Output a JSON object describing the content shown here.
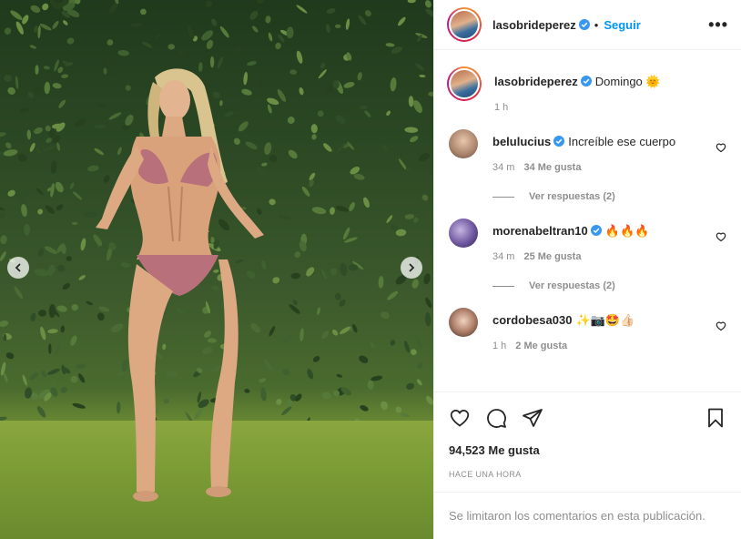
{
  "colors": {
    "accent": "#0095f6",
    "text": "#262626",
    "muted": "#8e8e8e",
    "border": "#efefef",
    "verified": "#3897f0"
  },
  "header": {
    "username": "lasobrideperez",
    "separator": "•",
    "follow_label": "Seguir",
    "more_icon": "more-horizontal-icon"
  },
  "caption": {
    "username": "lasobrideperez",
    "text": "Domingo 🌞",
    "time": "1 h"
  },
  "comments": [
    {
      "username": "belulucius",
      "verified": true,
      "text": "Increíble ese cuerpo",
      "time": "34 m",
      "likes": "34 Me gusta",
      "replies": "Ver respuestas (2)",
      "avatar_color": "#c9a38a"
    },
    {
      "username": "morenabeltran10",
      "verified": true,
      "text": "🔥🔥🔥",
      "time": "34 m",
      "likes": "25 Me gusta",
      "replies": "Ver respuestas (2)",
      "avatar_color": "#7d5fa8"
    },
    {
      "username": "cordobesa030",
      "verified": false,
      "text": "✨📷🤩👍🏻",
      "time": "1 h",
      "likes": "2 Me gusta",
      "replies": "",
      "avatar_color": "#a87360"
    }
  ],
  "actions": {
    "like_icon": "heart-icon",
    "comment_icon": "comment-icon",
    "share_icon": "share-icon",
    "save_icon": "bookmark-icon"
  },
  "likes_count": "94,523 Me gusta",
  "posted": "HACE UNA HORA",
  "restricted_text": "Se limitaron los comentarios en esta publicación."
}
